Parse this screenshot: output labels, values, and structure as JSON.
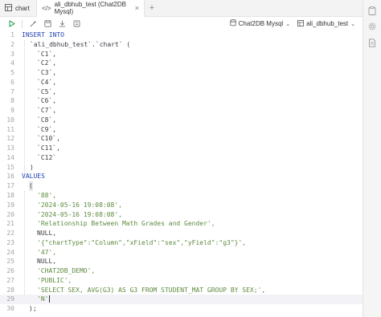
{
  "tabs": [
    {
      "label": "chart",
      "icon": "table-icon"
    },
    {
      "label": "ali_dbhub_test (Chat2DB Mysql)",
      "icon": "code-icon",
      "close": "×"
    }
  ],
  "toolbar": {
    "database_type": "Chat2DB Mysql",
    "database_name": "ali_dbhub_test"
  },
  "editor": {
    "lines": [
      {
        "n": "1",
        "text": "INSERT INTO"
      },
      {
        "n": "2",
        "text": "`ali_dbhub_test`.`chart` ("
      },
      {
        "n": "3",
        "text": "`C1`,"
      },
      {
        "n": "4",
        "text": "`C2`,"
      },
      {
        "n": "5",
        "text": "`C3`,"
      },
      {
        "n": "6",
        "text": "`C4`,"
      },
      {
        "n": "7",
        "text": "`C5`,"
      },
      {
        "n": "8",
        "text": "`C6`,"
      },
      {
        "n": "9",
        "text": "`C7`,"
      },
      {
        "n": "10",
        "text": "`C8`,"
      },
      {
        "n": "11",
        "text": "`C9`,"
      },
      {
        "n": "12",
        "text": "`C10`,"
      },
      {
        "n": "13",
        "text": "`C11`,"
      },
      {
        "n": "14",
        "text": "`C12`"
      },
      {
        "n": "15",
        "text": ")"
      },
      {
        "n": "16",
        "text": "VALUES"
      },
      {
        "n": "17",
        "text": "("
      },
      {
        "n": "18",
        "text": "'88',"
      },
      {
        "n": "19",
        "text": "'2024-05-16 19:08:08',"
      },
      {
        "n": "20",
        "text": "'2024-05-16 19:08:08',"
      },
      {
        "n": "21",
        "text": "'Relationship Between Math Grades and Gender',"
      },
      {
        "n": "22",
        "text": "NULL,"
      },
      {
        "n": "23",
        "text": "'{\"chartType\":\"Column\",\"xField\":\"sex\",\"yField\":\"g3\"}',"
      },
      {
        "n": "24",
        "text": "'47',"
      },
      {
        "n": "25",
        "text": "NULL,"
      },
      {
        "n": "26",
        "text": "'CHAT2DB_DEMO',"
      },
      {
        "n": "27",
        "text": "'PUBLIC',"
      },
      {
        "n": "28",
        "text": "'SELECT SEX, AVG(G3) AS G3 FROM STUDENT_MAT GROUP BY SEX;',"
      },
      {
        "n": "29",
        "text": "'N'"
      },
      {
        "n": "30",
        "text": ");"
      }
    ]
  },
  "colors": {
    "keyword": "#1f3fb0",
    "string": "#5d8a3e",
    "run": "#2ea44f"
  }
}
